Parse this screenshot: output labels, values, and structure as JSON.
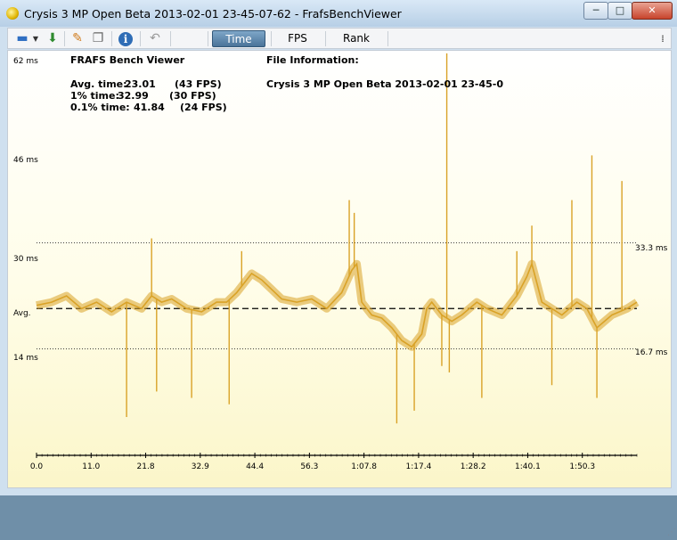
{
  "window": {
    "title": "Crysis 3 MP Open Beta 2013-02-01 23-45-07-62 - FrafsBenchViewer",
    "min_label": "─",
    "max_label": "□",
    "close_label": "✕"
  },
  "toolbar": {
    "icons": [
      "open-folder-icon",
      "dropdown-arrow-icon",
      "save-icon",
      "palette-icon",
      "copy-icon",
      "info-icon",
      "undo-icon",
      "more-icon"
    ],
    "tabs": [
      {
        "label": "Time",
        "active": true
      },
      {
        "label": "FPS",
        "active": false
      },
      {
        "label": "Rank",
        "active": false
      }
    ]
  },
  "overlay": {
    "app_title": "FRAFS Bench Viewer",
    "avg_label": "Avg. time:",
    "avg_value": "23.01",
    "avg_fps": "(43 FPS)",
    "p1_label": "1% time:",
    "p1_value": "32.99",
    "p1_fps": "(30 FPS)",
    "p01_label": "0.1% time:",
    "p01_value": "41.84",
    "p01_fps": "(24 FPS)",
    "file_info_label": "File Information:",
    "file_info_value": "Crysis 3 MP Open Beta 2013-02-01 23-45-0"
  },
  "chart_data": {
    "type": "line",
    "title": "",
    "xlabel": "",
    "ylabel": "",
    "y_ticks": [
      {
        "value": 62,
        "label": "62 ms"
      },
      {
        "value": 46,
        "label": "46 ms"
      },
      {
        "value": 30,
        "label": "30 ms"
      },
      {
        "value": 23.01,
        "label": "Avg."
      },
      {
        "value": 14,
        "label": "14 ms"
      }
    ],
    "ylim": [
      0,
      62
    ],
    "x_ticks": [
      "0.0",
      "11.0",
      "21.8",
      "32.9",
      "44.4",
      "56.3",
      "1:07.8",
      "1:17.4",
      "1:28.2",
      "1:40.1",
      "1:50.3"
    ],
    "xlim": [
      0,
      120
    ],
    "reference_lines": [
      {
        "value": 33.3,
        "label": "33.3 ms",
        "style": "dotted"
      },
      {
        "value": 23.01,
        "label": "",
        "style": "dashed"
      },
      {
        "value": 16.7,
        "label": "16.7 ms",
        "style": "dotted"
      }
    ],
    "series": [
      {
        "color": "#d9a227",
        "x": [
          0,
          3,
          6,
          9,
          12,
          15,
          18,
          21,
          23,
          25,
          27,
          30,
          33,
          36,
          38,
          40,
          43,
          45,
          47,
          49,
          52,
          55,
          58,
          61,
          63,
          64,
          65,
          67,
          69,
          71,
          73,
          75,
          77,
          78,
          79,
          81,
          83,
          85,
          88,
          90,
          93,
          96,
          98,
          99,
          100,
          101,
          103,
          105,
          108,
          110,
          112,
          115,
          118,
          120
        ],
        "y": [
          23.5,
          24,
          25,
          23,
          24,
          22.5,
          24,
          23,
          25,
          24,
          24.5,
          23,
          22.5,
          24,
          24,
          25.5,
          28.5,
          27.5,
          26,
          24.5,
          24,
          24.5,
          23,
          25.5,
          29,
          30,
          24,
          22,
          21.5,
          20,
          18,
          17,
          19,
          23,
          24,
          22,
          21,
          22,
          24,
          23,
          22,
          25,
          28,
          30,
          27,
          24,
          23,
          22,
          24,
          23,
          20,
          22,
          23,
          24
        ]
      }
    ],
    "spikes": [
      {
        "x": 23,
        "y": 34
      },
      {
        "x": 41,
        "y": 32
      },
      {
        "x": 62.5,
        "y": 40
      },
      {
        "x": 63.5,
        "y": 38
      },
      {
        "x": 82,
        "y": 63
      },
      {
        "x": 96,
        "y": 32
      },
      {
        "x": 99,
        "y": 36
      },
      {
        "x": 107,
        "y": 40
      },
      {
        "x": 111,
        "y": 47
      },
      {
        "x": 117,
        "y": 43
      },
      {
        "x": 18,
        "y": 6
      },
      {
        "x": 24,
        "y": 10
      },
      {
        "x": 31,
        "y": 9
      },
      {
        "x": 38.5,
        "y": 8
      },
      {
        "x": 72,
        "y": 5
      },
      {
        "x": 75.5,
        "y": 7
      },
      {
        "x": 81,
        "y": 14
      },
      {
        "x": 82.5,
        "y": 13
      },
      {
        "x": 89,
        "y": 9
      },
      {
        "x": 103,
        "y": 11
      },
      {
        "x": 112,
        "y": 9
      }
    ]
  }
}
